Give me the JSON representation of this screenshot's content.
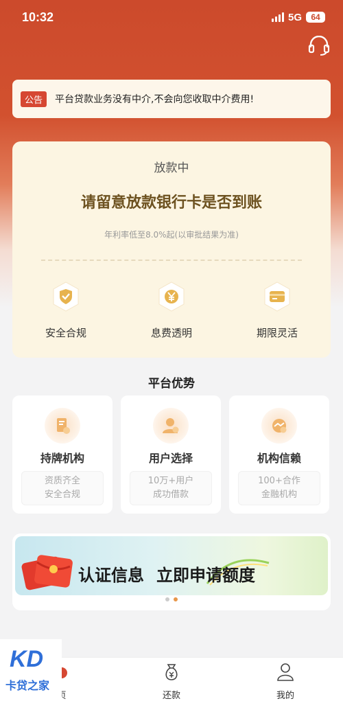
{
  "status_bar": {
    "time": "10:32",
    "network": "5G",
    "battery": "64"
  },
  "notice": {
    "tag": "公告",
    "text": "平台贷款业务没有中介,不会向您收取中介费用!"
  },
  "loan_card": {
    "status": "放款中",
    "headline": "请留意放款银行卡是否到账",
    "rate_note": "年利率低至8.0%起(以审批结果为准)",
    "features": [
      {
        "icon": "shield-check-icon",
        "label": "安全合规"
      },
      {
        "icon": "yen-coin-icon",
        "label": "息费透明"
      },
      {
        "icon": "card-icon",
        "label": "期限灵活"
      }
    ]
  },
  "advantages": {
    "title": "平台优势",
    "cards": [
      {
        "icon": "license-icon",
        "title": "持牌机构",
        "desc_line1": "资质齐全",
        "desc_line2": "安全合规"
      },
      {
        "icon": "user-icon",
        "title": "用户选择",
        "desc_line1": "10万+用户",
        "desc_line2": "成功借款"
      },
      {
        "icon": "handshake-icon",
        "title": "机构信赖",
        "desc_line1": "100+合作",
        "desc_line2": "金融机构"
      }
    ]
  },
  "promo": {
    "part1": "认证信息",
    "part2": "立即申请额度",
    "active_index": 1,
    "total": 2
  },
  "tabbar": {
    "tabs": [
      {
        "icon": "home-icon",
        "label": "页"
      },
      {
        "icon": "repay-icon",
        "label": "还款"
      },
      {
        "icon": "profile-icon",
        "label": "我的"
      }
    ]
  },
  "watermark": {
    "logo": "KD",
    "text": "卡贷之家"
  },
  "colors": {
    "brand_red": "#cc4a2c",
    "card_cream": "#fcf5e2",
    "tag_red": "#d64732",
    "accent_orange": "#e8974a"
  }
}
